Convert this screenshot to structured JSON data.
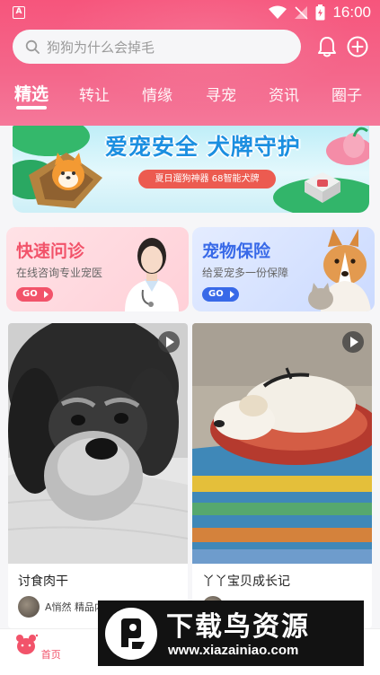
{
  "status_bar": {
    "time": "16:00",
    "app_badge": "A"
  },
  "search": {
    "placeholder": "狗狗为什么会掉毛"
  },
  "header_icons": [
    "bell-icon",
    "add-icon"
  ],
  "tabs": [
    {
      "label": "精选",
      "active": true
    },
    {
      "label": "转让",
      "active": false
    },
    {
      "label": "情缘",
      "active": false
    },
    {
      "label": "寻宠",
      "active": false
    },
    {
      "label": "资讯",
      "active": false
    },
    {
      "label": "圈子",
      "active": false
    }
  ],
  "banner": {
    "title": "爱宠安全 犬牌守护",
    "subtitle": "夏日遛狗神器  68智能犬牌"
  },
  "quick_cards": [
    {
      "title": "快速问诊",
      "subtitle": "在线咨询专业宠医",
      "go": "GO",
      "accent": "#f2536a"
    },
    {
      "title": "宠物保险",
      "subtitle": "给爱宠多一份保障",
      "go": "GO",
      "accent": "#3869e8"
    }
  ],
  "posts": [
    {
      "title": "讨食肉干",
      "author": "A悄然 精品内",
      "is_video": true
    },
    {
      "title": "丫丫宝贝成长记",
      "author": "",
      "is_video": true
    }
  ],
  "bottom_nav": [
    {
      "label": "首页",
      "active": true
    },
    {
      "label": "",
      "active": false
    }
  ],
  "watermark": {
    "title": "下载鸟资源",
    "url": "www.xiazainiao.com"
  },
  "colors": {
    "brand": "#f6557c",
    "accent_red": "#f2536a",
    "accent_blue": "#3869e8"
  }
}
